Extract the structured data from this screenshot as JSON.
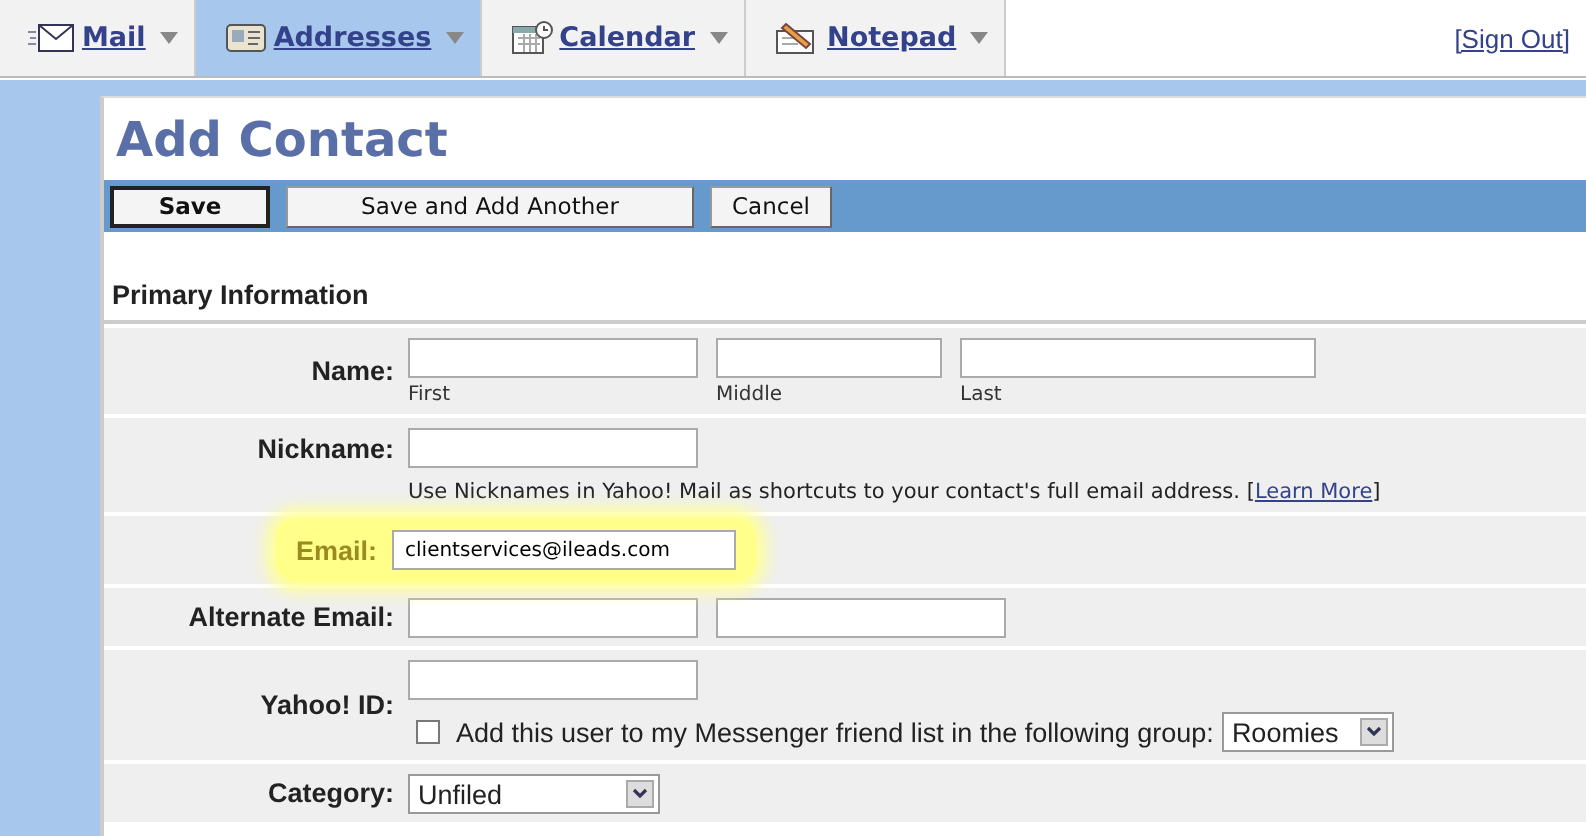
{
  "nav": {
    "tabs": [
      {
        "label": "Mail",
        "selected": false
      },
      {
        "label": "Addresses",
        "selected": true
      },
      {
        "label": "Calendar",
        "selected": false
      },
      {
        "label": "Notepad",
        "selected": false
      }
    ],
    "sign_out": "[Sign Out]"
  },
  "title": "Add Contact",
  "buttons": [
    {
      "label": "Save",
      "primary": true
    },
    {
      "label": "Save and Add Another",
      "primary": false
    },
    {
      "label": "Cancel",
      "primary": false
    }
  ],
  "section_title": "Primary Information",
  "rows": [
    {
      "label": "Name:",
      "highlighted": false,
      "fields": [
        {
          "kind": "input",
          "sublabel": "First"
        },
        {
          "kind": "input",
          "sublabel": "Middle"
        },
        {
          "kind": "input",
          "sublabel": "Last"
        }
      ]
    },
    {
      "label": "Nickname:",
      "highlighted": false,
      "fields": [
        {
          "kind": "input"
        }
      ],
      "hint": {
        "text": "Use Nicknames in Yahoo! Mail as shortcuts to your contact's full email address. [",
        "link": "Learn More",
        "after": "]"
      }
    },
    {
      "label": "Email:",
      "highlighted": true,
      "fields": [
        {
          "kind": "input",
          "value": "clientservices@ileads.com"
        }
      ]
    },
    {
      "label": "Alternate Email:",
      "highlighted": false,
      "fields": [
        {
          "kind": "input"
        },
        {
          "kind": "input"
        }
      ]
    },
    {
      "label": "Yahoo! ID:",
      "highlighted": false,
      "fields": [
        {
          "kind": "input"
        }
      ],
      "checkbox": {
        "label": "Add this user to my Messenger friend list in the following group:",
        "checked": false,
        "select": "Roomies"
      }
    },
    {
      "label": "Category:",
      "highlighted": false,
      "fields": [
        {
          "kind": "select",
          "value": "Unfiled"
        }
      ]
    }
  ]
}
